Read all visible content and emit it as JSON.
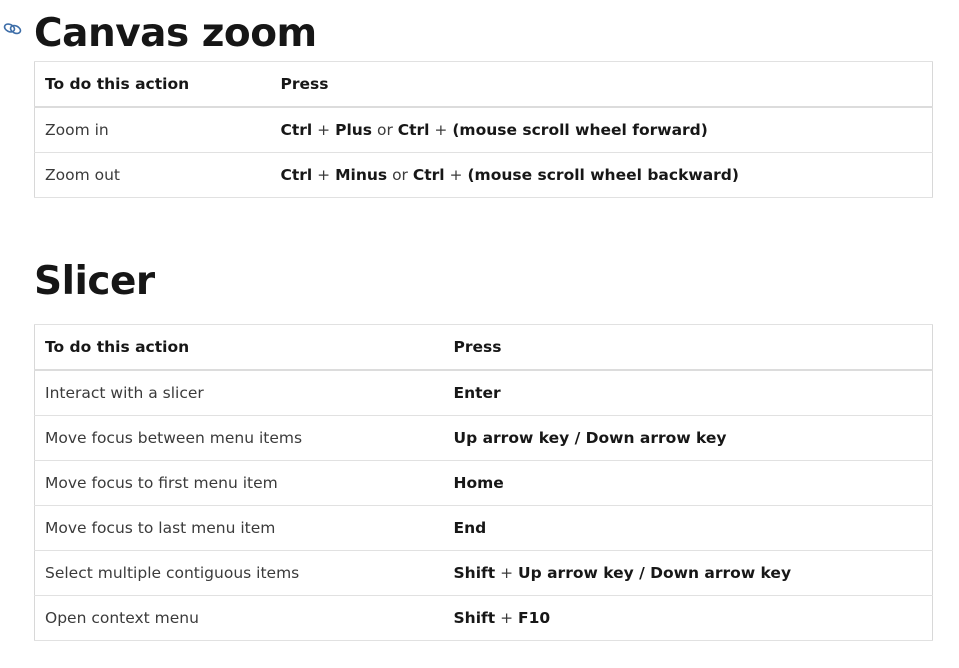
{
  "canvas_zoom": {
    "heading": "Canvas zoom",
    "headers": [
      "To do this action",
      "Press"
    ],
    "rows": [
      {
        "action": "Zoom in",
        "press": [
          {
            "t": "Ctrl",
            "b": true
          },
          {
            "t": " + ",
            "b": false
          },
          {
            "t": "Plus",
            "b": true
          },
          {
            "t": " or ",
            "b": false
          },
          {
            "t": "Ctrl",
            "b": true
          },
          {
            "t": " + ",
            "b": false
          },
          {
            "t": "(mouse scroll wheel forward)",
            "b": true
          }
        ]
      },
      {
        "action": "Zoom out",
        "press": [
          {
            "t": "Ctrl",
            "b": true
          },
          {
            "t": " + ",
            "b": false
          },
          {
            "t": "Minus",
            "b": true
          },
          {
            "t": " or ",
            "b": false
          },
          {
            "t": "Ctrl",
            "b": true
          },
          {
            "t": " + ",
            "b": false
          },
          {
            "t": "(mouse scroll wheel backward)",
            "b": true
          }
        ]
      }
    ]
  },
  "slicer": {
    "heading": "Slicer",
    "headers": [
      "To do this action",
      "Press"
    ],
    "rows": [
      {
        "action": "Interact with a slicer",
        "press": [
          {
            "t": "Enter",
            "b": true
          }
        ]
      },
      {
        "action": "Move focus between menu items",
        "press": [
          {
            "t": "Up arrow key / Down arrow key",
            "b": true
          }
        ]
      },
      {
        "action": "Move focus to first menu item",
        "press": [
          {
            "t": "Home",
            "b": true
          }
        ]
      },
      {
        "action": "Move focus to last menu item",
        "press": [
          {
            "t": "End",
            "b": true
          }
        ]
      },
      {
        "action": "Select multiple contiguous items",
        "press": [
          {
            "t": "Shift",
            "b": true
          },
          {
            "t": " + ",
            "b": false
          },
          {
            "t": "Up arrow key / Down arrow key",
            "b": true
          }
        ]
      },
      {
        "action": "Open context menu",
        "press": [
          {
            "t": "Shift",
            "b": true
          },
          {
            "t": " + ",
            "b": false
          },
          {
            "t": "F10",
            "b": true
          }
        ]
      }
    ]
  },
  "icons": {
    "anchor": "link-icon"
  }
}
